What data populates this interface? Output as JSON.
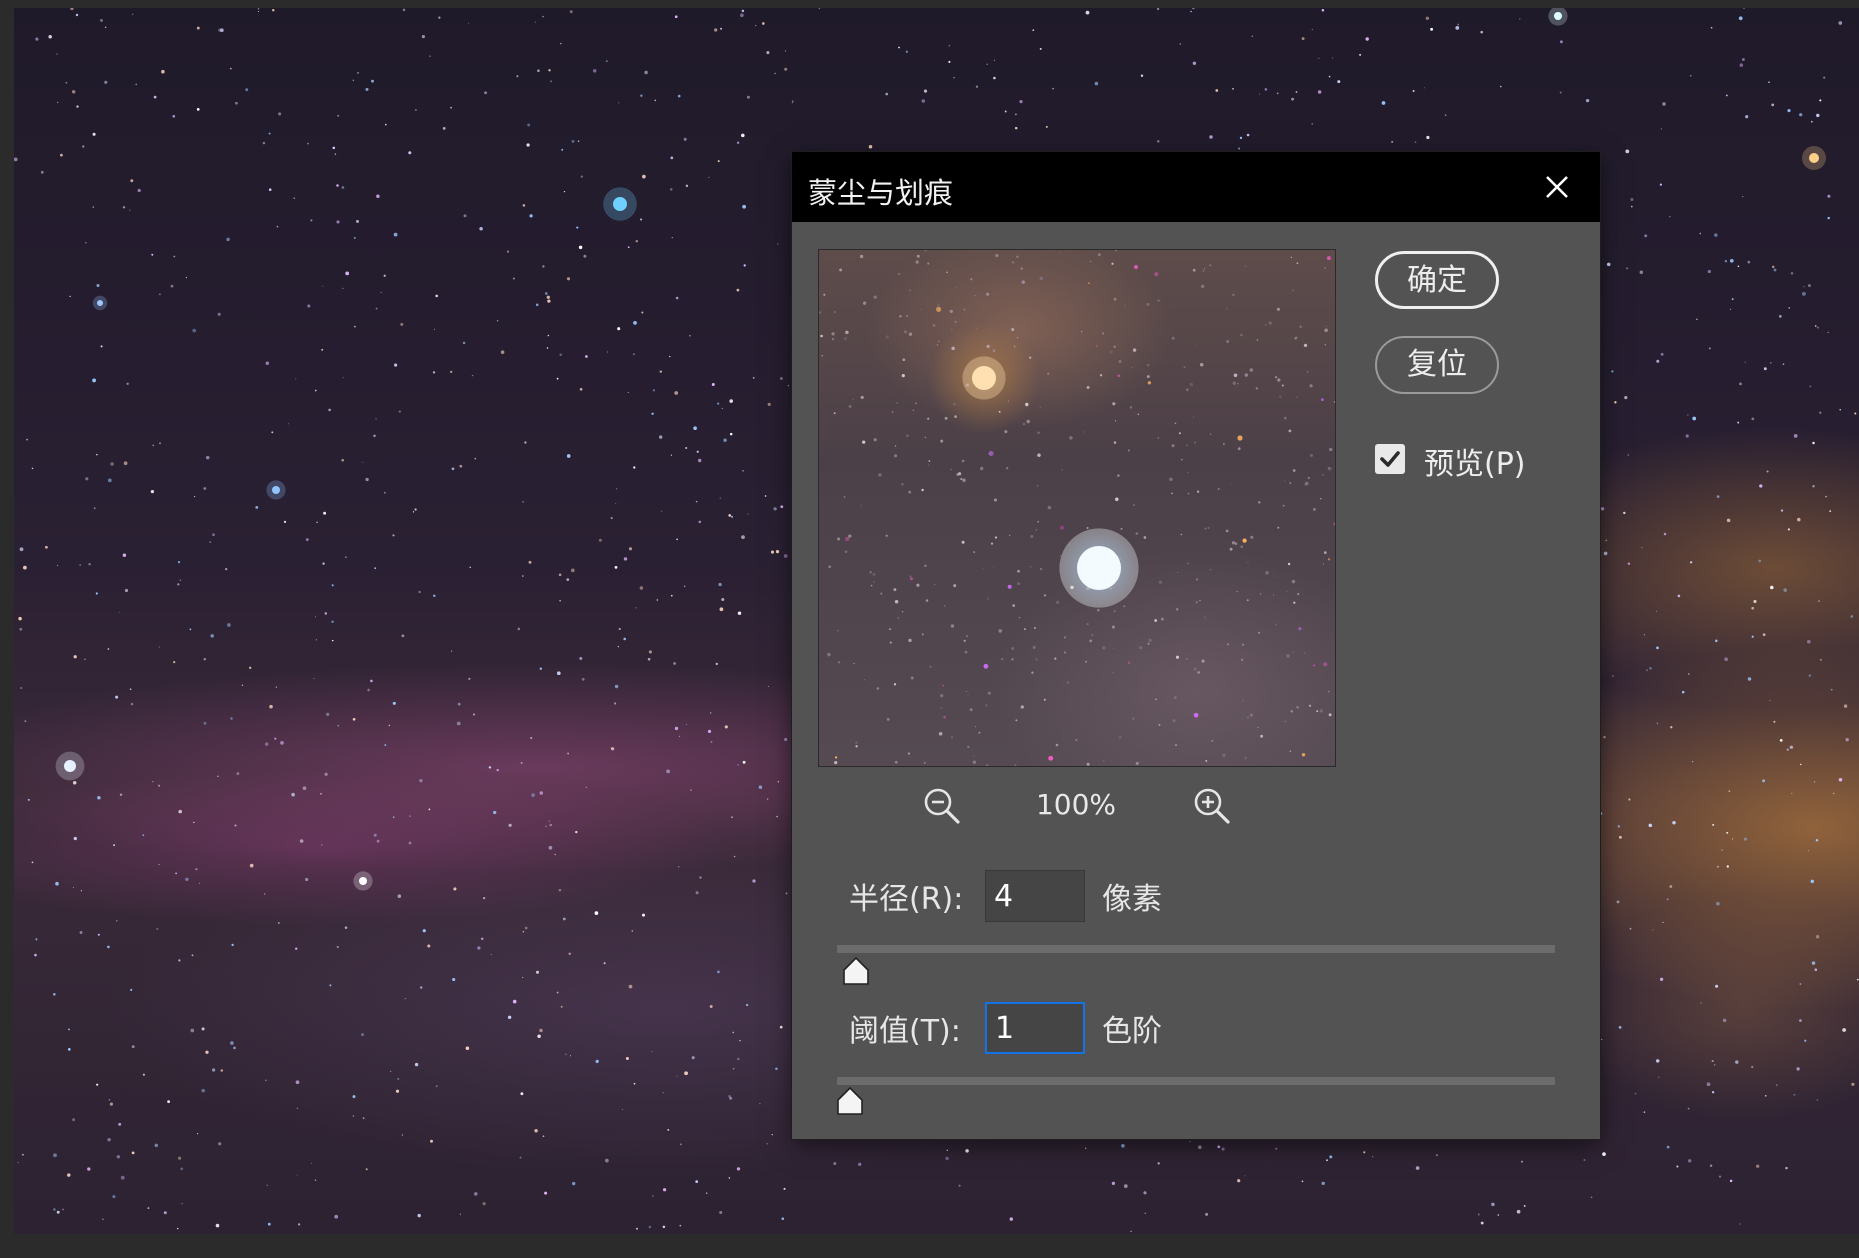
{
  "dialog": {
    "title": "蒙尘与划痕",
    "close_icon": "close-icon",
    "ok_label": "确定",
    "reset_label": "复位",
    "preview_checkbox": {
      "label": "预览(P)",
      "checked": true
    },
    "zoom": {
      "level": "100%",
      "zoom_out_icon": "zoom-out-icon",
      "zoom_in_icon": "zoom-in-icon"
    },
    "radius": {
      "label": "半径(R):",
      "value": "4",
      "unit": "像素",
      "slider_fraction": 0.012
    },
    "threshold": {
      "label": "阈值(T):",
      "value": "1",
      "unit": "色阶",
      "slider_fraction": 0.004
    }
  },
  "colors": {
    "dialog_bg": "#535353",
    "titlebar_bg": "#000000",
    "focus_accent": "#1473e6"
  }
}
